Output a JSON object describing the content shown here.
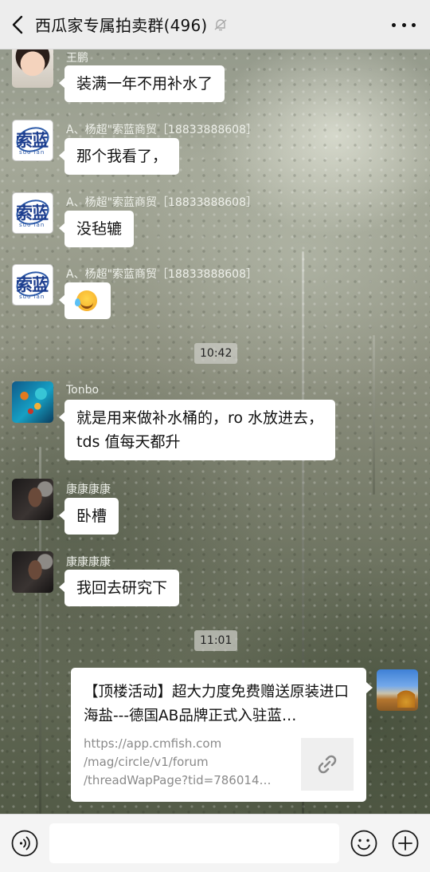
{
  "header": {
    "title": "西瓜家专属拍卖群(496)",
    "icons": {
      "back": "chevron-left-icon",
      "mute": "bell-off-icon",
      "more": "more-dots-icon"
    }
  },
  "messages": [
    {
      "sender": "王鹏",
      "text": "装满一年不用补水了",
      "avatar": "child-photo"
    },
    {
      "sender": "A、杨超\"索蓝商贸［18833888608］",
      "text": "那个我看了，",
      "avatar": "brand-logo"
    },
    {
      "sender": "A、杨超\"索蓝商贸［18833888608］",
      "text": "没毡辘",
      "avatar": "brand-logo"
    },
    {
      "sender": "A、杨超\"索蓝商贸［18833888608］",
      "text": "",
      "emoji": "laughing-crying-emoji",
      "avatar": "brand-logo"
    },
    {
      "sender": "Tonbo",
      "lines": [
        "就是用来做补水桶的，ro 水放进去，",
        "tds 值每天都升"
      ],
      "avatar": "fish-photo"
    },
    {
      "sender": "康康康康",
      "text": "卧槽",
      "avatar": "dark-photo"
    },
    {
      "sender": "康康康康",
      "text": "我回去研究下",
      "avatar": "dark-photo"
    }
  ],
  "timestamps": [
    "10:42",
    "11:01"
  ],
  "brand_logo": {
    "glyphs": "索蓝",
    "sub": "suo lan"
  },
  "link_card": {
    "title": "【顶楼活动】超大力度免费赠送原装进口海盐---德国AB品牌正式入驻蓝…",
    "desc_lines": [
      "https://app.cmfish.com",
      "/mag/circle/v1/forum",
      "/threadWapPage?tid=786014…"
    ],
    "thumb_icon": "link-icon"
  },
  "input_bar": {
    "voice_icon": "voice-icon",
    "emoji_icon": "emoji-icon",
    "plus_icon": "plus-icon",
    "placeholder": ""
  },
  "colors": {
    "header_bg": "#ededed",
    "bubble": "#ffffff",
    "link": "#8a8a8a"
  }
}
